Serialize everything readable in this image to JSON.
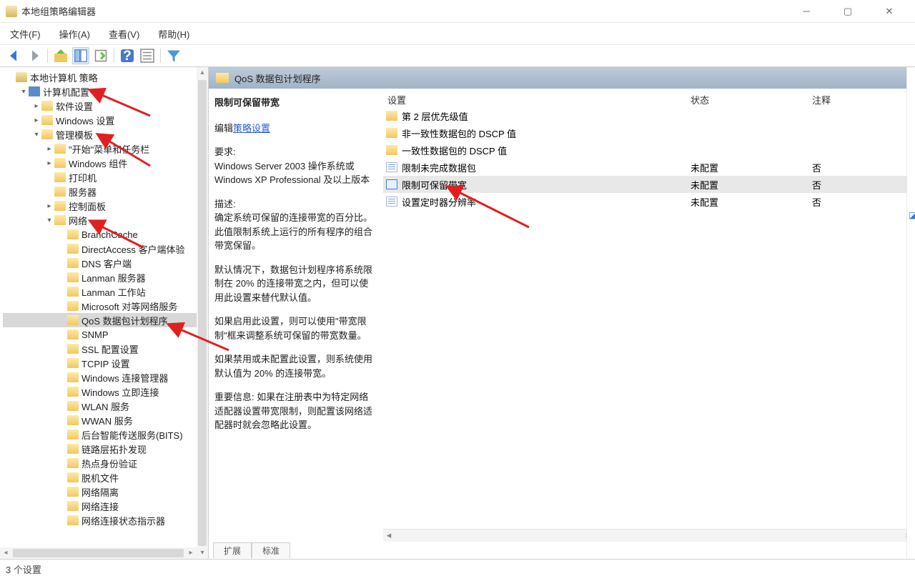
{
  "window": {
    "title": "本地组策略编辑器"
  },
  "menu": {
    "file": "文件(F)",
    "action": "操作(A)",
    "view": "查看(V)",
    "help": "帮助(H)"
  },
  "tree": [
    {
      "depth": 0,
      "arrow": "",
      "icon": "root",
      "label": "本地计算机 策略"
    },
    {
      "depth": 1,
      "arrow": "▾",
      "icon": "comp",
      "label": "计算机配置"
    },
    {
      "depth": 2,
      "arrow": "▸",
      "icon": "folder",
      "label": "软件设置"
    },
    {
      "depth": 2,
      "arrow": "▸",
      "icon": "folder",
      "label": "Windows 设置"
    },
    {
      "depth": 2,
      "arrow": "▾",
      "icon": "folder",
      "label": "管理模板"
    },
    {
      "depth": 3,
      "arrow": "▸",
      "icon": "folder",
      "label": "\"开始\"菜单和任务栏"
    },
    {
      "depth": 3,
      "arrow": "▸",
      "icon": "folder",
      "label": "Windows 组件"
    },
    {
      "depth": 3,
      "arrow": "",
      "icon": "folder",
      "label": "打印机"
    },
    {
      "depth": 3,
      "arrow": "",
      "icon": "folder",
      "label": "服务器"
    },
    {
      "depth": 3,
      "arrow": "▸",
      "icon": "folder",
      "label": "控制面板"
    },
    {
      "depth": 3,
      "arrow": "▾",
      "icon": "folder",
      "label": "网络"
    },
    {
      "depth": 4,
      "arrow": "",
      "icon": "folder",
      "label": "BranchCache"
    },
    {
      "depth": 4,
      "arrow": "",
      "icon": "folder",
      "label": "DirectAccess 客户端体验"
    },
    {
      "depth": 4,
      "arrow": "",
      "icon": "folder",
      "label": "DNS 客户端"
    },
    {
      "depth": 4,
      "arrow": "",
      "icon": "folder",
      "label": "Lanman 服务器"
    },
    {
      "depth": 4,
      "arrow": "",
      "icon": "folder",
      "label": "Lanman 工作站"
    },
    {
      "depth": 4,
      "arrow": "",
      "icon": "folder",
      "label": "Microsoft 对等网络服务"
    },
    {
      "depth": 4,
      "arrow": "",
      "icon": "folder",
      "label": "QoS 数据包计划程序",
      "selected": true
    },
    {
      "depth": 4,
      "arrow": "",
      "icon": "folder",
      "label": "SNMP"
    },
    {
      "depth": 4,
      "arrow": "",
      "icon": "folder",
      "label": "SSL 配置设置"
    },
    {
      "depth": 4,
      "arrow": "",
      "icon": "folder",
      "label": "TCPIP 设置"
    },
    {
      "depth": 4,
      "arrow": "",
      "icon": "folder",
      "label": "Windows 连接管理器"
    },
    {
      "depth": 4,
      "arrow": "",
      "icon": "folder",
      "label": "Windows 立即连接"
    },
    {
      "depth": 4,
      "arrow": "",
      "icon": "folder",
      "label": "WLAN 服务"
    },
    {
      "depth": 4,
      "arrow": "",
      "icon": "folder",
      "label": "WWAN 服务"
    },
    {
      "depth": 4,
      "arrow": "",
      "icon": "folder",
      "label": "后台智能传送服务(BITS)"
    },
    {
      "depth": 4,
      "arrow": "",
      "icon": "folder",
      "label": "链路层拓扑发现"
    },
    {
      "depth": 4,
      "arrow": "",
      "icon": "folder",
      "label": "热点身份验证"
    },
    {
      "depth": 4,
      "arrow": "",
      "icon": "folder",
      "label": "脱机文件"
    },
    {
      "depth": 4,
      "arrow": "",
      "icon": "folder",
      "label": "网络隔离"
    },
    {
      "depth": 4,
      "arrow": "",
      "icon": "folder",
      "label": "网络连接"
    },
    {
      "depth": 4,
      "arrow": "",
      "icon": "folder",
      "label": "网络连接状态指示器"
    }
  ],
  "content": {
    "header": "QoS 数据包计划程序",
    "setting_title": "限制可保留带宽",
    "edit_prefix": "编辑",
    "edit_link": "策略设置",
    "req_label": "要求:",
    "req_text": "Windows Server 2003 操作系统或 Windows XP Professional 及以上版本",
    "desc_label": "描述:",
    "p1": "确定系统可保留的连接带宽的百分比。此值限制系统上运行的所有程序的组合带宽保留。",
    "p2": "默认情况下，数据包计划程序将系统限制在 20% 的连接带宽之内，但可以使用此设置来替代默认值。",
    "p3": "如果启用此设置，则可以使用\"带宽限制\"框来调整系统可保留的带宽数量。",
    "p4": "如果禁用或未配置此设置，则系统使用默认值为 20% 的连接带宽。",
    "p5": "重要信息: 如果在注册表中为特定网络适配器设置带宽限制，则配置该网络适配器时就会忽略此设置。",
    "columns": {
      "setting": "设置",
      "state": "状态",
      "comment": "注释"
    },
    "rows": [
      {
        "icon": "folder",
        "name": "第 2 层优先级值",
        "state": "",
        "comment": ""
      },
      {
        "icon": "folder",
        "name": "非一致性数据包的 DSCP 值",
        "state": "",
        "comment": ""
      },
      {
        "icon": "folder",
        "name": "一致性数据包的 DSCP 值",
        "state": "",
        "comment": ""
      },
      {
        "icon": "doc",
        "name": "限制未完成数据包",
        "state": "未配置",
        "comment": "否"
      },
      {
        "icon": "doc-sel",
        "name": "限制可保留带宽",
        "state": "未配置",
        "comment": "否",
        "selected": true
      },
      {
        "icon": "doc",
        "name": "设置定时器分辨率",
        "state": "未配置",
        "comment": "否"
      }
    ],
    "tabs": {
      "extended": "扩展",
      "standard": "标准"
    }
  },
  "statusbar": "3 个设置"
}
